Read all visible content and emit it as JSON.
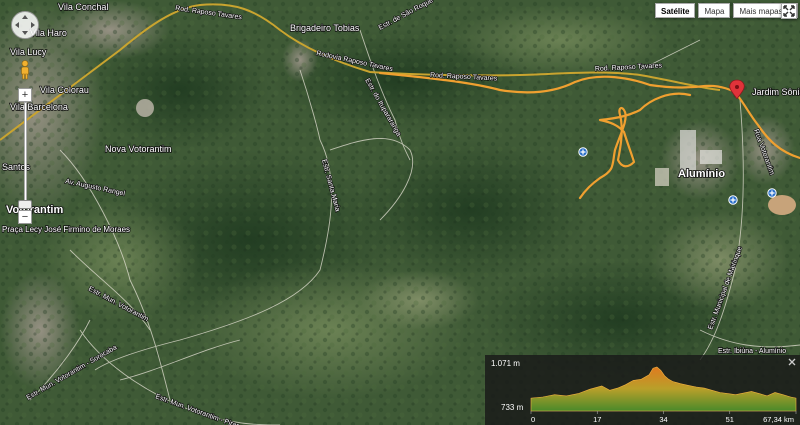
{
  "map": {
    "map_type_buttons": [
      {
        "label": "Satélite",
        "active": true
      },
      {
        "label": "Mapa",
        "active": false
      },
      {
        "label": "Mais mapas",
        "active": false
      }
    ],
    "towns": [
      {
        "name": "Votorantim"
      },
      {
        "name": "Alumínio"
      },
      {
        "name": "Brigadeiro Tobias"
      },
      {
        "name": "Vila Barcelona"
      },
      {
        "name": "Vila Colorau"
      },
      {
        "name": "Nova Votorantim"
      },
      {
        "name": "Vila Haro"
      },
      {
        "name": "Santos"
      },
      {
        "name": "Vila Conchal"
      },
      {
        "name": "Vila Lucy"
      },
      {
        "name": "Jardim Sônia Maria"
      },
      {
        "name": "Praça Lecy José Firmino de Moraes"
      }
    ],
    "roads": [
      {
        "name": "Rod. Raposo Tavares"
      },
      {
        "name": "Rod. Raposo Tavares"
      },
      {
        "name": "Rod. Raposo Tavares"
      },
      {
        "name": "Rodovia Raposo Tavares"
      },
      {
        "name": "Estr. de São Roque"
      },
      {
        "name": "Estr. do Itupararanga"
      },
      {
        "name": "Estr. Santa Maria"
      },
      {
        "name": "Estr. Mun. Votorantim"
      },
      {
        "name": "Estr. Mun. Votorantim - Pirapora"
      },
      {
        "name": "Estr. Mun. Votorantim - Sorocaba"
      },
      {
        "name": "Av. Augusto Rangel"
      },
      {
        "name": "Estr. Municipal de Mairinque"
      },
      {
        "name": "Estr. Ibiúna - Alumínio"
      },
      {
        "name": "Rua Votorantim"
      }
    ]
  },
  "elevation": {
    "max_label": "1.071 m",
    "min_label": "733 m",
    "ticks": [
      "0",
      "17",
      "34",
      "51",
      "67,34 km"
    ]
  },
  "chart_data": {
    "type": "area",
    "title": "",
    "xlabel": "",
    "ylabel": "",
    "x_unit": "km",
    "y_unit": "m",
    "xlim": [
      0,
      67.34
    ],
    "ylim": [
      733,
      1071
    ],
    "x": [
      0,
      3,
      6,
      9,
      12,
      15,
      18,
      20,
      22,
      24,
      26,
      28,
      30,
      31,
      32,
      33,
      34,
      35,
      36,
      37,
      38,
      40,
      42,
      44,
      46,
      48,
      50,
      52,
      54,
      56,
      58,
      60,
      62,
      64,
      66,
      67.34
    ],
    "y": [
      790,
      800,
      820,
      810,
      830,
      870,
      900,
      860,
      880,
      910,
      950,
      960,
      1000,
      1060,
      1071,
      1040,
      990,
      960,
      940,
      930,
      920,
      905,
      890,
      880,
      860,
      840,
      830,
      820,
      835,
      850,
      830,
      810,
      840,
      820,
      800,
      790
    ]
  }
}
